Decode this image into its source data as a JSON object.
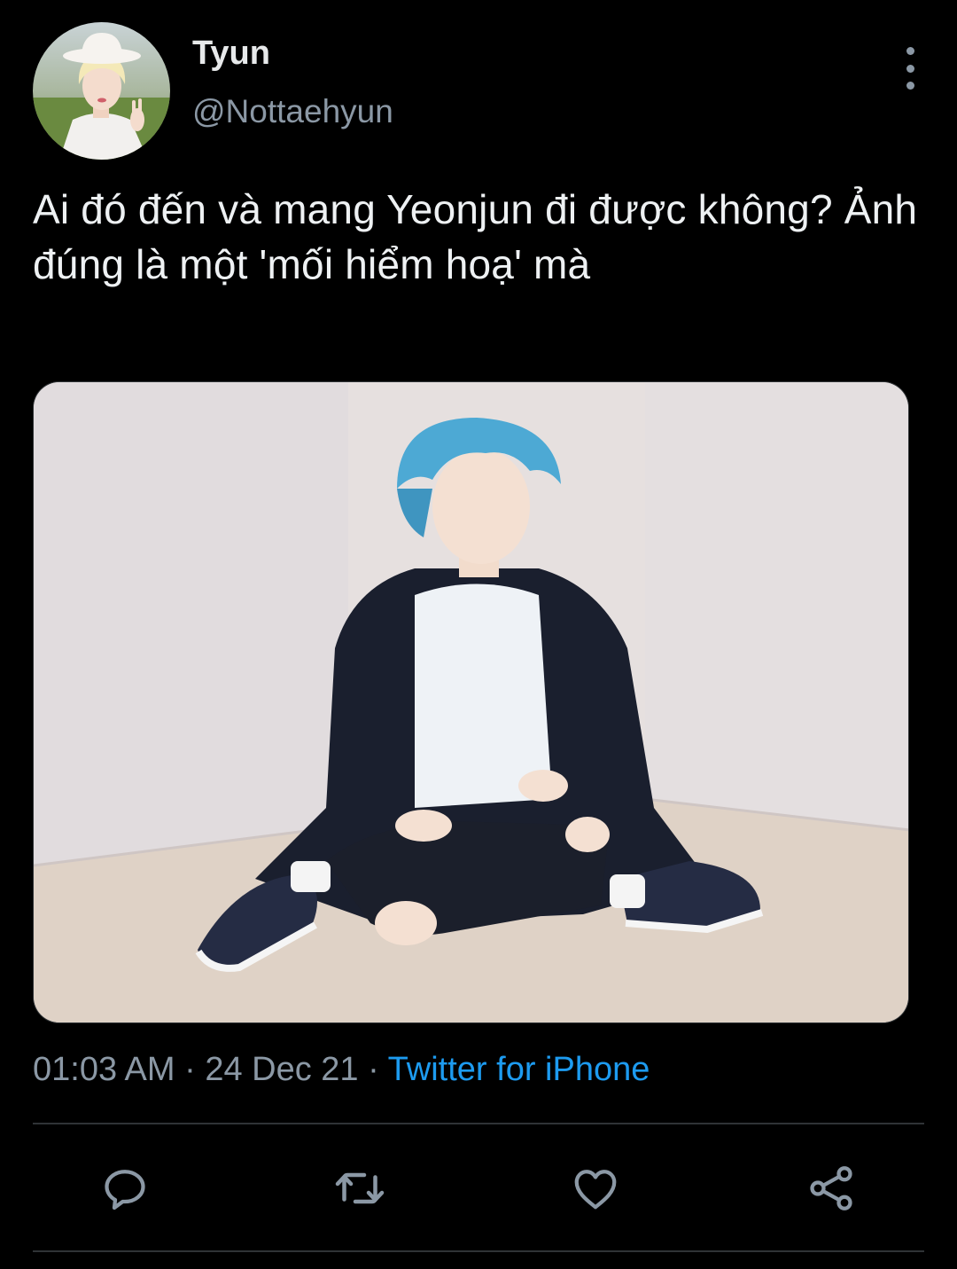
{
  "tweet": {
    "display_name": "Tyun",
    "handle": "@Nottaehyun",
    "text": "Ai đó đến và mang Yeonjun đi được không? Ảnh đúng là một 'mối hiểm hoạ' mà",
    "time": "01:03 AM",
    "date": "24 Dec 21",
    "source": "Twitter for iPhone",
    "separator": "·"
  },
  "icons": {
    "more": "more-vertical-icon",
    "reply": "reply-icon",
    "retweet": "retweet-icon",
    "like": "heart-icon",
    "share": "share-icon"
  },
  "colors": {
    "background": "#000000",
    "text": "#e7e9ea",
    "secondary": "#8b98a5",
    "link": "#1d9bf0",
    "divider": "#2f3336"
  }
}
